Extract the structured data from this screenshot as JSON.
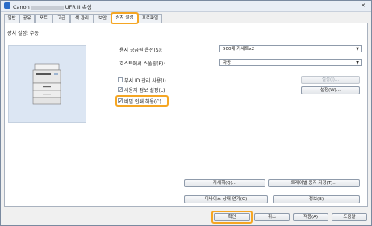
{
  "window": {
    "title_prefix": "Canon",
    "title_suffix": "UFR II 속성",
    "close_glyph": "✕"
  },
  "tabs": [
    {
      "label": "일반"
    },
    {
      "label": "공유"
    },
    {
      "label": "포트"
    },
    {
      "label": "고급"
    },
    {
      "label": "색 관리"
    },
    {
      "label": "보안"
    },
    {
      "label": "장치 설정"
    },
    {
      "label": "프로파일"
    }
  ],
  "section": {
    "label": "장치 설정: 수동"
  },
  "settings": {
    "paper_source_label": "용지 공급원 옵션(S):",
    "paper_source_value": "500매 카세트x2",
    "spooling_label": "호스트에서 스풀링(P):",
    "spooling_value": "자동"
  },
  "checkboxes": {
    "dept_id_label": "부서 ID 관리 사용(I)",
    "dept_id_checked": false,
    "user_info_label": "사용자 정보 설정(L)",
    "user_info_checked": true,
    "secure_print_label": "비밀 인쇄 허용(C)",
    "secure_print_checked": true,
    "check_glyph": "✓"
  },
  "buttons": {
    "settings_disabled": "설정(I)...",
    "settings_w": "설정(W)...",
    "details": "자세히(Q)...",
    "tray_paper": "트레이별 용지 지정(T)...",
    "device_status": "디바이스 상태 얻기(G)",
    "info": "정보(B)",
    "ok": "확인",
    "cancel": "취소",
    "apply": "적용(A)",
    "help": "도움말"
  },
  "colors": {
    "highlight": "#f5a623",
    "preview_bg": "#dce6f3"
  }
}
